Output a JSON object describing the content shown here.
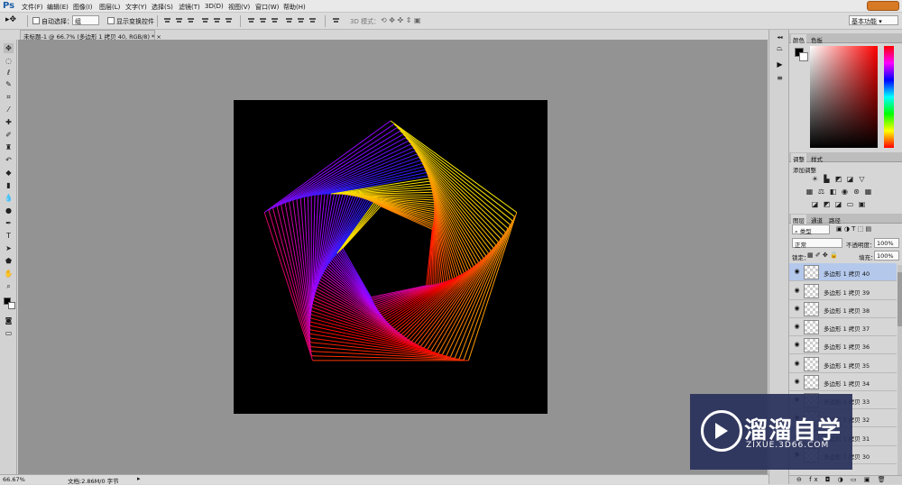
{
  "app": {
    "logo": "Ps"
  },
  "menu": [
    "文件(F)",
    "编辑(E)",
    "图像(I)",
    "图层(L)",
    "文字(Y)",
    "选择(S)",
    "滤镜(T)",
    "3D(D)",
    "视图(V)",
    "窗口(W)",
    "帮助(H)"
  ],
  "options": {
    "auto_select_label": "自动选择：",
    "auto_select_value": "组",
    "show_transform_label": "显示变换控件",
    "mode_3d_label": "3D 模式：",
    "workspace": "基本功能"
  },
  "document": {
    "tab_title": "未标题-1 @ 66.7% (多边形 1 拷贝 40, RGB/8) *"
  },
  "status": {
    "zoom": "66.67%",
    "doc_info": "文档:2.86M/0 字节"
  },
  "color_panel": {
    "tabs": [
      "颜色",
      "色板"
    ],
    "foreground": "#000000",
    "background": "#ffffff"
  },
  "adjust_panel": {
    "tabs": [
      "调整",
      "样式"
    ],
    "add_label": "添加调整"
  },
  "layers_panel": {
    "tabs": [
      "图层",
      "通道",
      "路径"
    ],
    "filter": "类型",
    "blend_mode": "正常",
    "opacity_label": "不透明度：",
    "opacity": "100%",
    "lock_label": "锁定：",
    "fill_label": "填充：",
    "fill": "100%",
    "layers": [
      "多边形 1 拷贝 40",
      "多边形 1 拷贝 39",
      "多边形 1 拷贝 38",
      "多边形 1 拷贝 37",
      "多边形 1 拷贝 36",
      "多边形 1 拷贝 35",
      "多边形 1 拷贝 34",
      "多边形 1 拷贝 33",
      "多边形 1 拷贝 32",
      "多边形 1 拷贝 31",
      "多边形 1 拷贝 30"
    ]
  },
  "watermark": {
    "title": "溜溜自学",
    "url": "ZIXUE.3D66.COM"
  },
  "artwork": {
    "copies": 40,
    "rotation_step_deg": 1.5,
    "scale_step": 0.975,
    "colors": [
      "#ffee00",
      "#ff8800",
      "#ff0000",
      "#b000ff",
      "#2020ff"
    ]
  }
}
